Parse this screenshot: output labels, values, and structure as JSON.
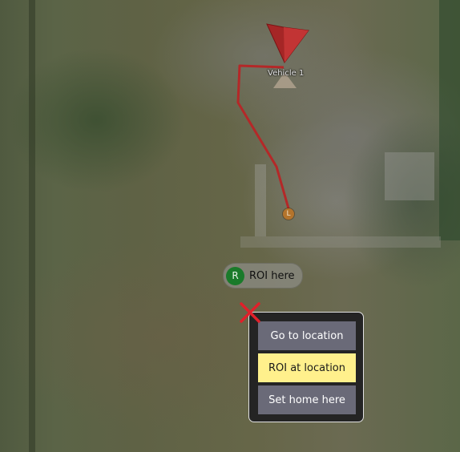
{
  "map": {
    "vehicle": {
      "label": "Vehicle 1",
      "heading_icon": "vehicle-arrow-icon"
    },
    "flight_path_color": "#b42828",
    "launch_marker": {
      "label": "L",
      "color": "#b4742c"
    },
    "roi_marker": {
      "badge": "R",
      "label": "ROI here",
      "badge_color": "#1a7a2a"
    }
  },
  "popup": {
    "close_icon": "close-x-icon",
    "close_color": "#e0202a",
    "buttons": [
      {
        "label": "Go to location",
        "state": "normal"
      },
      {
        "label": "ROI at location",
        "state": "highlighted"
      },
      {
        "label": "Set home here",
        "state": "normal"
      }
    ],
    "colors": {
      "button": "#6a6a78",
      "highlight": "#fff08c",
      "background": "#242424"
    }
  }
}
